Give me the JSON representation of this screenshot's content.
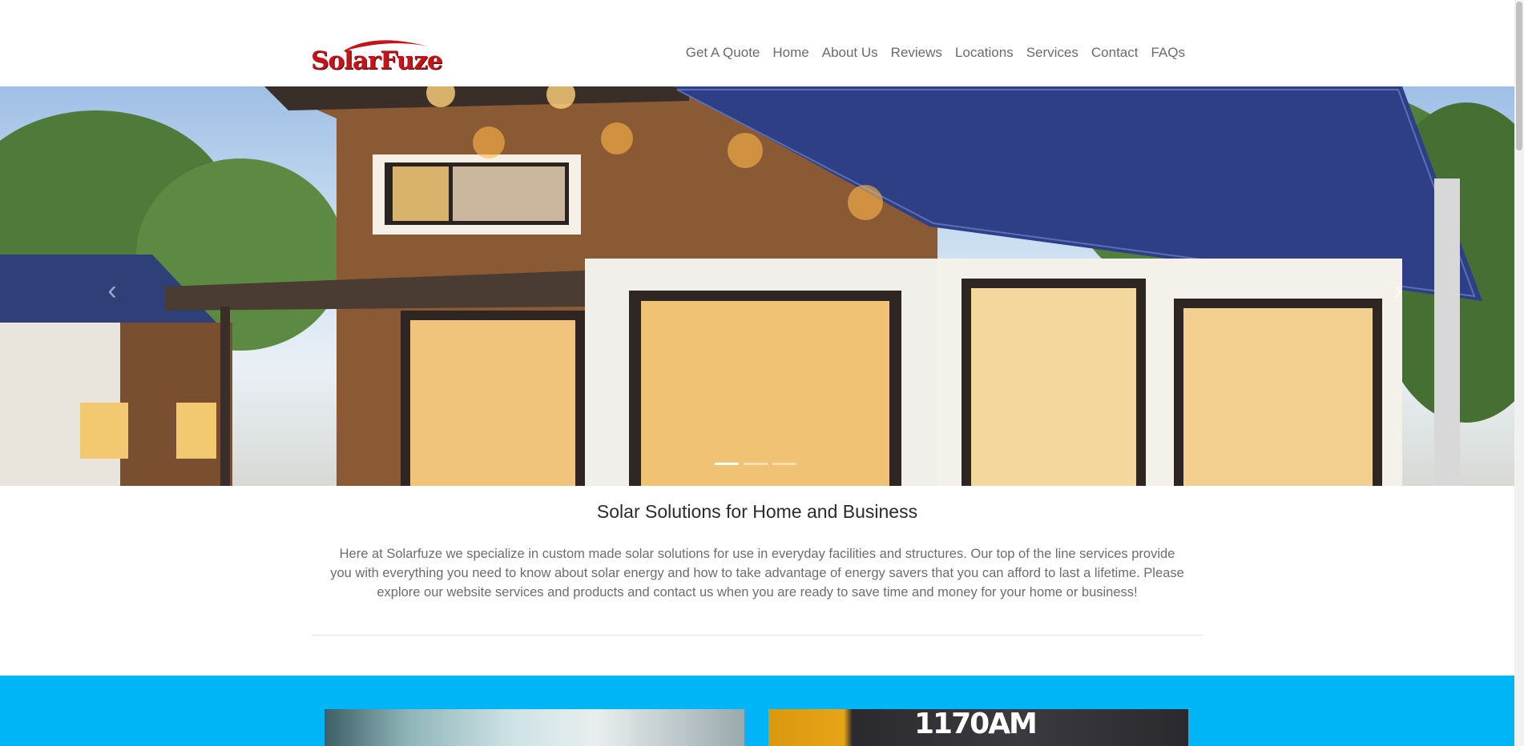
{
  "header": {
    "logo_text": "SolarFuze",
    "nav": [
      {
        "label": "Get A Quote"
      },
      {
        "label": "Home"
      },
      {
        "label": "About Us"
      },
      {
        "label": "Reviews"
      },
      {
        "label": "Locations"
      },
      {
        "label": "Services"
      },
      {
        "label": "Contact"
      },
      {
        "label": "FAQs"
      }
    ]
  },
  "hero": {
    "prev_icon": "chevron-left-icon",
    "next_icon": "chevron-right-icon",
    "prev_glyph": "‹",
    "next_glyph": "›",
    "slide_count": 3,
    "active_slide": 1
  },
  "intro": {
    "title": "Solar Solutions for Home and Business",
    "text": "Here at Solarfuze we specialize in custom made solar solutions for use in everyday facilities and structures. Our top of the line services provide you with everything you need to know about solar energy and how to take advantage of energy savers that you can afford to last a lifetime. Please explore our website services and products and contact us when you are ready to save time and money for your home or business!"
  },
  "features": {
    "band_color": "#00b5f5",
    "right_card_text": "1170AM"
  },
  "colors": {
    "brand_red": "#c4141a",
    "nav_text": "#6b6b6b",
    "accent_blue": "#00b5f5"
  }
}
